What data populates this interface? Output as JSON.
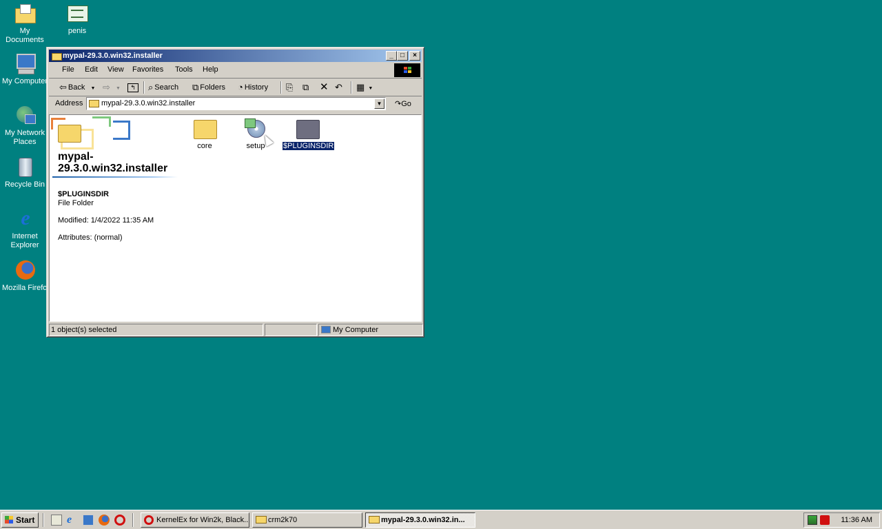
{
  "desktop": {
    "icons": [
      {
        "label": "My Documents",
        "icon": "my-documents-icon"
      },
      {
        "label": "penis",
        "icon": "file-icon"
      },
      {
        "label": "My Computer",
        "icon": "my-computer-icon"
      },
      {
        "label": "My Network Places",
        "icon": "network-icon"
      },
      {
        "label": "Recycle Bin",
        "icon": "recycle-bin-icon"
      },
      {
        "label": "Internet Explorer",
        "icon": "internet-explorer-icon"
      },
      {
        "label": "Mozilla Firefox",
        "icon": "firefox-icon"
      }
    ]
  },
  "window": {
    "title": "mypal-29.3.0.win32.installer",
    "menu": [
      "File",
      "Edit",
      "View",
      "Favorites",
      "Tools",
      "Help"
    ],
    "toolbar": {
      "back": "Back",
      "search": "Search",
      "folders": "Folders",
      "history": "History"
    },
    "address": {
      "label": "Address",
      "value": "mypal-29.3.0.win32.installer",
      "go": "Go"
    },
    "panel": {
      "folder_title": "mypal-29.3.0.win32.installer",
      "selected_name": "$PLUGINSDIR",
      "selected_type": "File Folder",
      "modified": "Modified: 1/4/2022 11:35 AM",
      "attributes": "Attributes: (normal)"
    },
    "files": [
      {
        "name": "core",
        "icon": "folder-icon"
      },
      {
        "name": "setup",
        "icon": "setup-installer-icon"
      },
      {
        "name": "$PLUGINSDIR",
        "icon": "hidden-folder-icon",
        "selected": true
      }
    ],
    "status": {
      "selection": "1 object(s) selected",
      "zone": "My Computer"
    }
  },
  "taskbar": {
    "start": "Start",
    "tasks": [
      {
        "label": "KernelEx for Win2k, Black...",
        "icon": "opera-icon"
      },
      {
        "label": "crm2k70",
        "icon": "folder-icon"
      },
      {
        "label": "mypal-29.3.0.win32.in...",
        "icon": "folder-icon",
        "active": true
      }
    ],
    "clock": "11:36 AM"
  },
  "colors": {
    "desktop": "#008080",
    "titlebar_start": "#0a246a",
    "titlebar_end": "#a6caf0",
    "selection": "#0a246a"
  }
}
